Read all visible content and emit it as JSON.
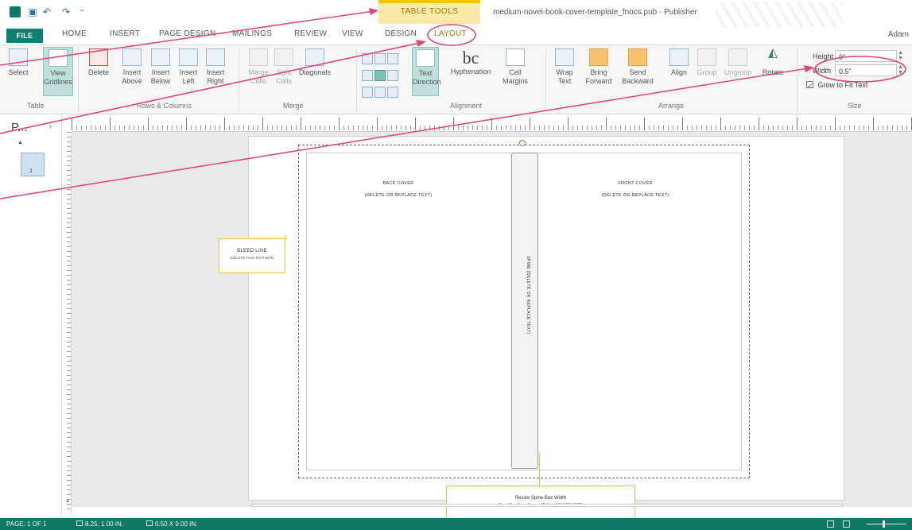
{
  "titlebar": {
    "table_tools": "TABLE TOOLS",
    "doc_title": "medium-novel-book-cover-template_fnocs.pub - Publisher",
    "user": "Adam"
  },
  "tabs": [
    "FILE",
    "HOME",
    "INSERT",
    "PAGE DESIGN",
    "MAILINGS",
    "REVIEW",
    "VIEW",
    "DESIGN",
    "LAYOUT"
  ],
  "ribbon": {
    "table_group": {
      "label": "Table",
      "buttons": [
        {
          "label": "Select",
          "icon": "cursor-icon"
        },
        {
          "label": "View Gridlines",
          "icon": "gridlines-icon"
        }
      ]
    },
    "rows_columns": {
      "label": "Rows & Columns",
      "buttons": [
        {
          "label": "Delete",
          "icon": "delete-table-icon"
        },
        {
          "label": "Insert Above",
          "icon": "insert-above-icon"
        },
        {
          "label": "Insert Below",
          "icon": "insert-below-icon"
        },
        {
          "label": "Insert Left",
          "icon": "insert-left-icon"
        },
        {
          "label": "Insert Right",
          "icon": "insert-right-icon"
        }
      ]
    },
    "merge": {
      "label": "Merge",
      "buttons": [
        {
          "label": "Merge Cells",
          "icon": "merge-cells-icon"
        },
        {
          "label": "Split Cells",
          "icon": "split-cells-icon"
        },
        {
          "label": "Diagonals",
          "icon": "diagonals-icon"
        }
      ]
    },
    "alignment": {
      "label": "Alignment",
      "buttons": [
        {
          "label": "Text Direction",
          "icon": "text-direction-icon"
        },
        {
          "label": "Hyphenation",
          "icon": "hyphenation-icon"
        },
        {
          "label": "Cell Margins",
          "icon": "cell-margins-icon"
        }
      ]
    },
    "arrange": {
      "label": "Arrange",
      "buttons": [
        {
          "label": "Wrap Text",
          "icon": "wrap-text-icon"
        },
        {
          "label": "Bring Forward",
          "icon": "bring-forward-icon"
        },
        {
          "label": "Send Backward",
          "icon": "send-backward-icon"
        },
        {
          "label": "Align",
          "icon": "align-icon"
        },
        {
          "label": "Group",
          "icon": "group-icon"
        },
        {
          "label": "Ungroup",
          "icon": "ungroup-icon"
        },
        {
          "label": "Rotate",
          "icon": "rotate-icon"
        }
      ]
    },
    "size": {
      "label": "Size",
      "height_label": "Height",
      "height_value": "9\"",
      "width_label": "Width",
      "width_value": "0.5\"",
      "grow_label": "Grow to Fit Text"
    }
  },
  "pages_pane": {
    "title": "P...",
    "page_number": "1"
  },
  "document": {
    "back_cover": "BACK COVER",
    "back_cover_sub": "(DELETE OR REPLACE TEXT)",
    "front_cover": "FRONT COVER",
    "front_cover_sub": "(DELETE OR REPLACE TEXT)",
    "spine_text": "SPINE (DELETE OR REPLACE TEXT)",
    "bleed_title": "BLEED LINE",
    "bleed_sub": "(DELETE THIS TEXT BOX)",
    "spine_note_title": "Resize Spine Box Width",
    "spine_note_sub": "Read Text Box - Format Wdth... DELETE NOTE"
  },
  "statusbar": {
    "page": "PAGE: 1 OF 1",
    "position": "8.25, 1.00 IN.",
    "size": "0.50 X 9.00 IN."
  },
  "colors": {
    "brand": "#117a67",
    "annotation": "#e0457b",
    "table_tools": "#f2c300"
  }
}
